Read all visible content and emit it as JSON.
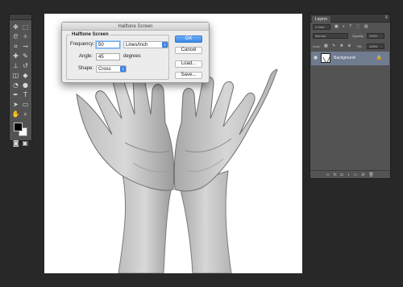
{
  "dialog": {
    "title": "Halftone Screen",
    "group_title": "Halftone Screen",
    "frequency_label": "Frequency:",
    "frequency_value": "50",
    "frequency_unit": "Lines/Inch",
    "angle_label": "Angle:",
    "angle_value": "45",
    "angle_unit": "degrees",
    "shape_label": "Shape:",
    "shape_value": "Cross",
    "ok_label": "OK",
    "cancel_label": "Cancel",
    "load_label": "Load...",
    "save_label": "Save..."
  },
  "layers_panel": {
    "tab_label": "Layers",
    "kind_label": "Kind",
    "blend_mode": "Normal",
    "opacity_label": "Opacity:",
    "opacity_value": "100%",
    "lock_label": "Lock:",
    "fill_label": "Fill:",
    "fill_value": "100%",
    "layer_name": "Background"
  },
  "colors": {
    "app_background": "#282828",
    "panel": "#535353",
    "selected_layer": "#6f7c8f",
    "dialog_accent": "#3a87e6"
  }
}
